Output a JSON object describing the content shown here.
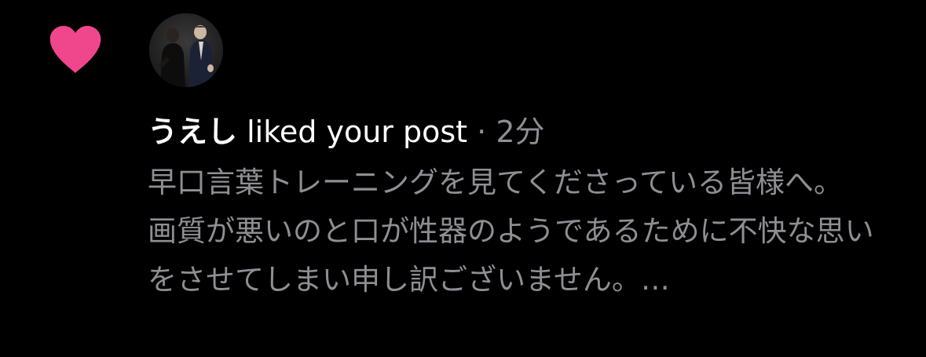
{
  "notification": {
    "type_icon": "heart-icon",
    "icon_color": "#f0468c",
    "avatar": "user-avatar-photo",
    "username": "うえし",
    "action": "liked your post",
    "separator": "·",
    "time": "2分",
    "post_excerpt": "早口言葉トレーニングを見てくださっている皆様へ。\n画質が悪いのと口が性器のようであるために不快な思いをさせてしまい申し訳ございません。…"
  },
  "colors": {
    "background": "#000000",
    "primary_text": "#ffffff",
    "secondary_text": "#8e8e93"
  }
}
